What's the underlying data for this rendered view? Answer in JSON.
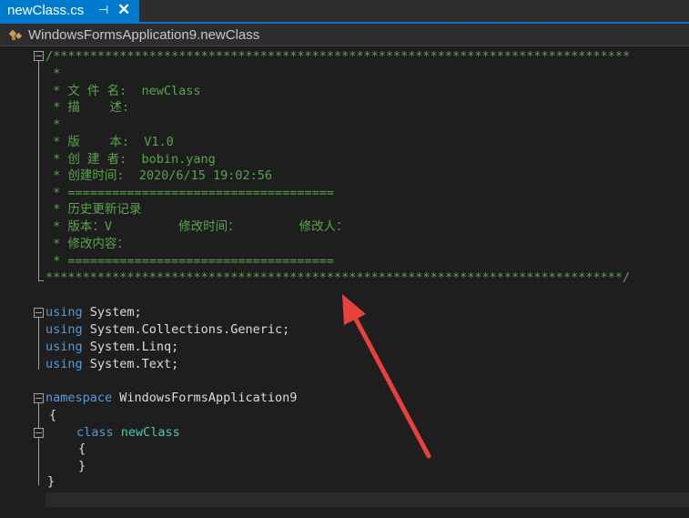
{
  "tab": {
    "title": "newClass.cs",
    "pin_glyph": "⊣",
    "close_glyph": "✕"
  },
  "navbar": {
    "label": "WindowsFormsApplication9.newClass"
  },
  "code": {
    "comment_lines": [
      "/******************************************************************************",
      " *",
      " * 文 件 名:  newClass",
      " * 描    述:",
      " *",
      " * 版    本:  V1.0",
      " * 创 建 者:  bobin.yang",
      " * 创建时间:  2020/6/15 19:02:56",
      " * ====================================",
      " * 历史更新记录",
      " * 版本：V         修改时间：        修改人：",
      " * 修改内容：",
      " * ====================================",
      "******************************************************************************/"
    ],
    "using": [
      {
        "kw": "using",
        "ns": " System;"
      },
      {
        "kw": "using",
        "ns": " System.Collections.Generic;"
      },
      {
        "kw": "using",
        "ns": " System.Linq;"
      },
      {
        "kw": "using",
        "ns": " System.Text;"
      }
    ],
    "namespace_kw": "namespace",
    "namespace_name": " WindowsFormsApplication9",
    "open_brace": "{",
    "class_kw": "class",
    "class_name": " newClass",
    "class_open": "{",
    "class_close": "}",
    "close_brace": "}"
  }
}
